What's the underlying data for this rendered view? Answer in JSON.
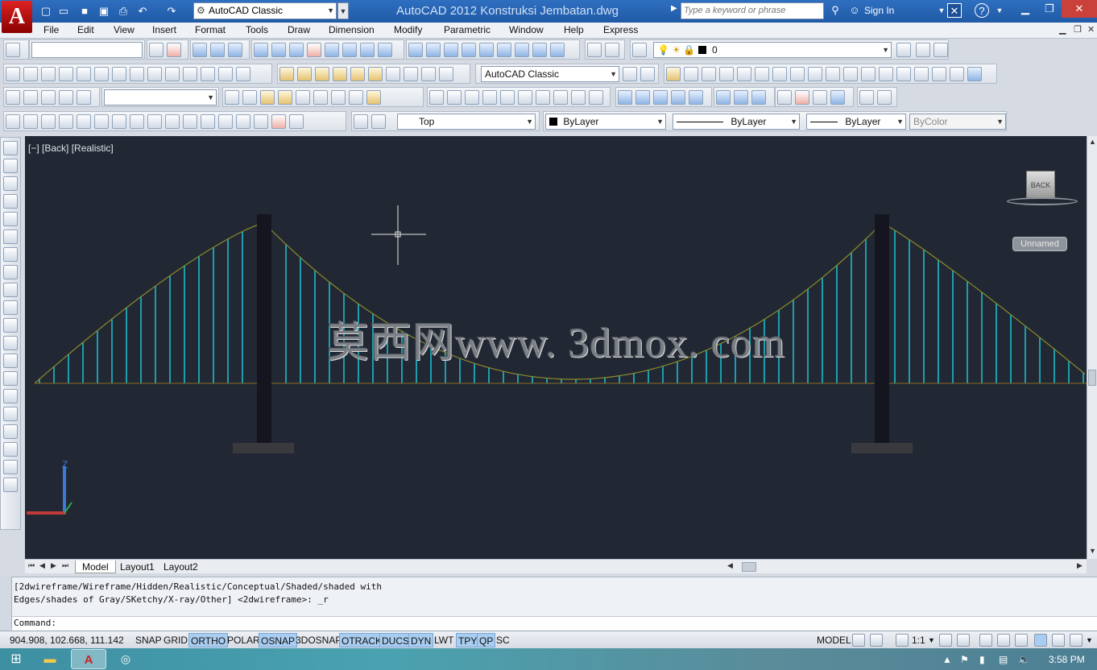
{
  "title_bar": {
    "app_title": "AutoCAD 2012    Konstruksi Jembatan.dwg",
    "workspace": "AutoCAD Classic",
    "search_placeholder": "Type a keyword or phrase",
    "sign_in": "Sign In",
    "help_glyph": "?",
    "logo_letter": "A"
  },
  "menu": [
    "File",
    "Edit",
    "View",
    "Insert",
    "Format",
    "Tools",
    "Draw",
    "Dimension",
    "Modify",
    "Parametric",
    "Window",
    "Help",
    "Express"
  ],
  "toolbars": {
    "layer_value": "0",
    "workspace_combo": "AutoCAD Classic",
    "view_combo": "Top",
    "color_combo": "ByLayer",
    "linetype_combo": "ByLayer",
    "lineweight_combo": "ByLayer",
    "plotstyle_combo": "ByColor"
  },
  "viewport": {
    "label": "[−] [Back] [Realistic]",
    "viewcube_face": "BACK",
    "ucs_name": "Unnamed",
    "watermark": "莫西网www. 3dmox. com",
    "axis_label": "Z",
    "colors": {
      "background": "#222833",
      "hanger": "#19d0e0",
      "cable": "#8a8a2a",
      "tower": "#151520"
    }
  },
  "tabs": [
    "Model",
    "Layout1",
    "Layout2"
  ],
  "command": {
    "history": [
      "[2dwireframe/Wireframe/Hidden/Realistic/Conceptual/Shaded/shaded with",
      "Edges/shades of Gray/SKetchy/X-ray/Other] <2dwireframe>: _r"
    ],
    "prompt": "Command:"
  },
  "status": {
    "coordinates": "904.908, 102.668, 111.142",
    "toggles": [
      {
        "label": "SNAP",
        "on": false
      },
      {
        "label": "GRID",
        "on": false
      },
      {
        "label": "ORTHO",
        "on": true
      },
      {
        "label": "POLAR",
        "on": false
      },
      {
        "label": "OSNAP",
        "on": true
      },
      {
        "label": "3DOSNAP",
        "on": false
      },
      {
        "label": "OTRACK",
        "on": true
      },
      {
        "label": "DUCS",
        "on": true
      },
      {
        "label": "DYN",
        "on": true
      },
      {
        "label": "LWT",
        "on": false
      },
      {
        "label": "TPY",
        "on": true
      },
      {
        "label": "QP",
        "on": true
      },
      {
        "label": "SC",
        "on": false
      }
    ],
    "space": "MODEL",
    "scale": "1:1"
  },
  "taskbar": {
    "time": "3:58 PM"
  }
}
